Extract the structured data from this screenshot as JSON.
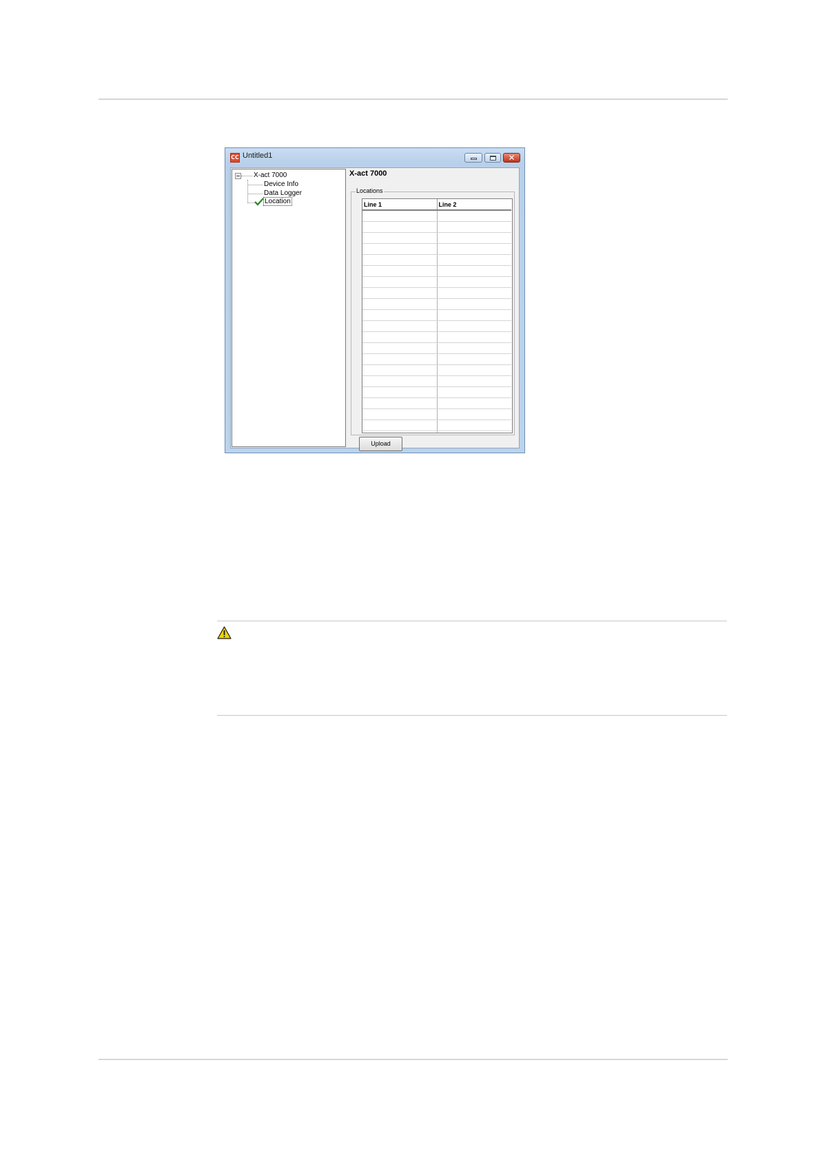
{
  "window": {
    "title": "Untitled1",
    "app_icon_text": "CC",
    "buttons": {
      "minimize": "minimize",
      "maximize": "maximize",
      "close": "✕"
    }
  },
  "tree": {
    "root": "X-act 7000",
    "children": [
      "Device Info",
      "Data Logger",
      "Location"
    ],
    "selected": "Location"
  },
  "panel": {
    "device_title": "X-act 7000",
    "group_label": "Locations",
    "columns": [
      "Line 1",
      "Line 2"
    ],
    "rows": [
      [
        "",
        ""
      ],
      [
        "",
        ""
      ],
      [
        "",
        ""
      ],
      [
        "",
        ""
      ],
      [
        "",
        ""
      ],
      [
        "",
        ""
      ],
      [
        "",
        ""
      ],
      [
        "",
        ""
      ],
      [
        "",
        ""
      ],
      [
        "",
        ""
      ],
      [
        "",
        ""
      ],
      [
        "",
        ""
      ],
      [
        "",
        ""
      ],
      [
        "",
        ""
      ],
      [
        "",
        ""
      ],
      [
        "",
        ""
      ],
      [
        "",
        ""
      ],
      [
        "",
        ""
      ],
      [
        "",
        ""
      ],
      [
        "",
        ""
      ],
      [
        "",
        ""
      ]
    ],
    "upload_label": "Upload"
  },
  "icons": {
    "warning": "warning-triangle-icon",
    "check": "check-icon"
  },
  "colors": {
    "warning": "#f2d300",
    "check": "#2e8b2e",
    "close_button": "#c2331c"
  }
}
